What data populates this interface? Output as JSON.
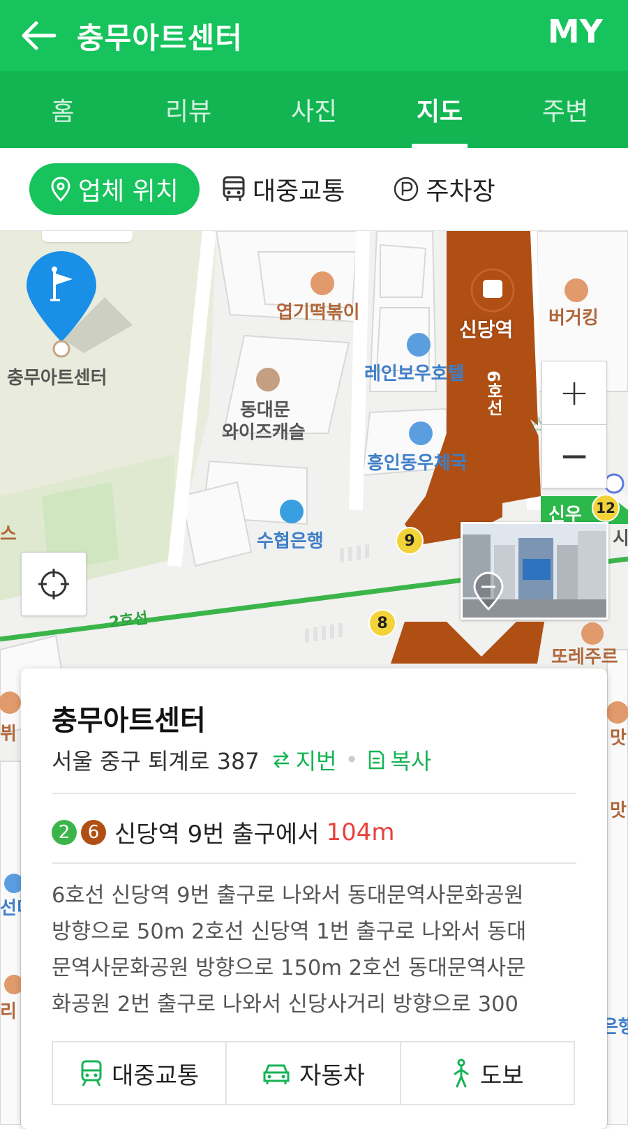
{
  "header": {
    "title": "충무아트센터",
    "my_label": "MY"
  },
  "tabs": [
    {
      "label": "홈"
    },
    {
      "label": "리뷰"
    },
    {
      "label": "사진"
    },
    {
      "label": "지도",
      "active": true
    },
    {
      "label": "주변"
    }
  ],
  "filters": {
    "location": "업체 위치",
    "transit": "대중교통",
    "parking": "주차장"
  },
  "map": {
    "labels": {
      "place_main": "충무아트센터",
      "restaurant1": "엽기떡볶이",
      "station": "신당역",
      "burger": "버거킹",
      "hotel": "레인보우호텔",
      "line6": "6호선",
      "castle1": "동대문",
      "castle2": "와이즈캐슬",
      "post": "흥인동우체국",
      "bank": "수협은행",
      "line2": "2호선",
      "exit9": "9",
      "exit8": "8",
      "exit12": "12",
      "edge_left1": "스",
      "edge_sinu": "신우",
      "edge_right1": "시",
      "edge_ddeok": "또레주르",
      "edge_bue": "뷔",
      "edge_mat": "맛",
      "edge_mat2": "맛",
      "edge_seon": "선미",
      "edge_ri": "리",
      "edge_eun": "은행",
      "edge_star": "스타벅스"
    },
    "zoom_in": "+",
    "zoom_out": "−"
  },
  "card": {
    "name": "충무아트센터",
    "address": "서울 중구 퇴계로 387",
    "jibun_label": "지번",
    "copy_label": "복사",
    "line2_badge": "2",
    "line6_badge": "6",
    "station_text": "신당역 9번 출구에서",
    "distance": "104m",
    "description_lines": [
      "6호선 신당역 9번 출구로 나와서 동대문역사문화공원",
      "방향으로 50m 2호선 신당역 1번 출구로 나와서 동대",
      "문역사문화공원 방향으로 150m 2호선 동대문역사문",
      "화공원 2번 출구로 나와서 신당사거리 방향으로 300"
    ],
    "route_transit": "대중교통",
    "route_car": "자동차",
    "route_walk": "도보"
  },
  "colors": {
    "brand_green": "#16c35c",
    "tab_green": "#13b553",
    "line6_brown": "#b04f13",
    "line2_green": "#3bb54a",
    "distance_red": "#e8413d",
    "pin_blue": "#1a8fe8"
  }
}
